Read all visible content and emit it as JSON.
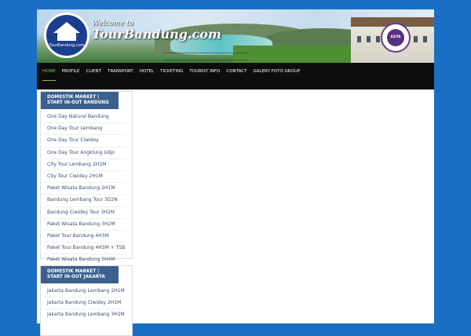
{
  "header": {
    "welcome": "Welcome to",
    "site_name": "TourBandung.com",
    "logo_text": "TourBandung.com",
    "seal_text": "ASITA"
  },
  "nav": {
    "items": [
      {
        "label": "Home",
        "active": true
      },
      {
        "label": "Profile"
      },
      {
        "label": "Client"
      },
      {
        "label": "Transport"
      },
      {
        "label": "Hotel"
      },
      {
        "label": "Ticketing"
      },
      {
        "label": "Tourist Info"
      },
      {
        "label": "Contact"
      },
      {
        "label": "Galery Foto Group"
      }
    ]
  },
  "sidebar": {
    "widgets": [
      {
        "title_line1": "DOMESTIK MARKET |",
        "title_line2": "START IN-OUT BANDUNG",
        "items": [
          "One Day Natural Bandung",
          "One Day Tour Lembang",
          "One Day Tour Ciwidey",
          "One Day Tour Angklung Udjo",
          "City Tour Lembang 2H1M",
          "City Tour Ciwidey 2H1M",
          "Paket Wisata Bandung 2H1M",
          "Bandung Lembang Tour 3D2N",
          "Bandung Ciwidey Tour 3H2M",
          "Paket Wisata Bandung 3H2M",
          "Paket Tour Bandung 4H3M",
          "Paket Tour Bandung 4H3M + TSB",
          "Paket Wisata Bandung 5H4M"
        ]
      },
      {
        "title_line1": "DOMESTIK MARKET |",
        "title_line2": "START IN-OUT JAKARTA",
        "items": [
          "Jakarta Bandung Lembang 2H1M",
          "Jakarta Bandung Ciwidey 2H1M",
          "Jakarta Bandung Lembang 3H2M"
        ]
      }
    ]
  },
  "colors": {
    "background": "#1a6fc4",
    "nav": "#0d0d0d",
    "nav_active": "#7ec24a",
    "widget_title": "#3b5f8f",
    "link": "#3c4e6b"
  }
}
